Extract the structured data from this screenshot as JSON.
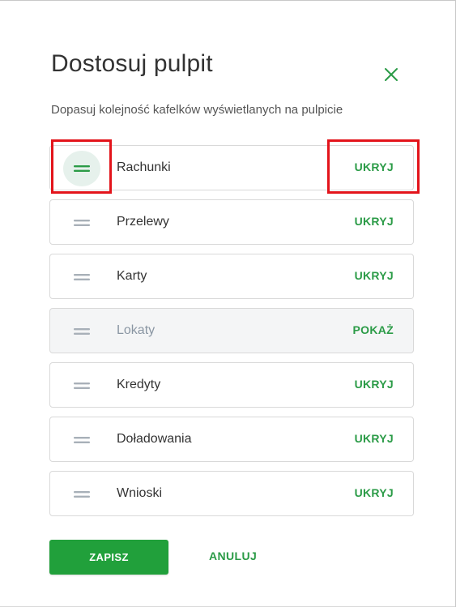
{
  "dialog": {
    "title": "Dostosuj pulpit",
    "subtitle": "Dopasuj kolejność kafelków wyświetlanych na pulpicie"
  },
  "tiles": [
    {
      "label": "Rachunki",
      "action": "UKRYJ",
      "visible": true
    },
    {
      "label": "Przelewy",
      "action": "UKRYJ",
      "visible": true
    },
    {
      "label": "Karty",
      "action": "UKRYJ",
      "visible": true
    },
    {
      "label": "Lokaty",
      "action": "POKAŻ",
      "visible": false
    },
    {
      "label": "Kredyty",
      "action": "UKRYJ",
      "visible": true
    },
    {
      "label": "Doładowania",
      "action": "UKRYJ",
      "visible": true
    },
    {
      "label": "Wnioski",
      "action": "UKRYJ",
      "visible": true
    }
  ],
  "footer": {
    "save_label": "ZAPISZ",
    "cancel_label": "ANULUJ"
  },
  "icons": {
    "close": "close-icon",
    "drag": "drag-handle-icon"
  },
  "colors": {
    "accent": "#2b9b47",
    "primary_button": "#21a03b",
    "highlight": "#e3141b",
    "hidden_tile_text": "#8a96a3"
  }
}
